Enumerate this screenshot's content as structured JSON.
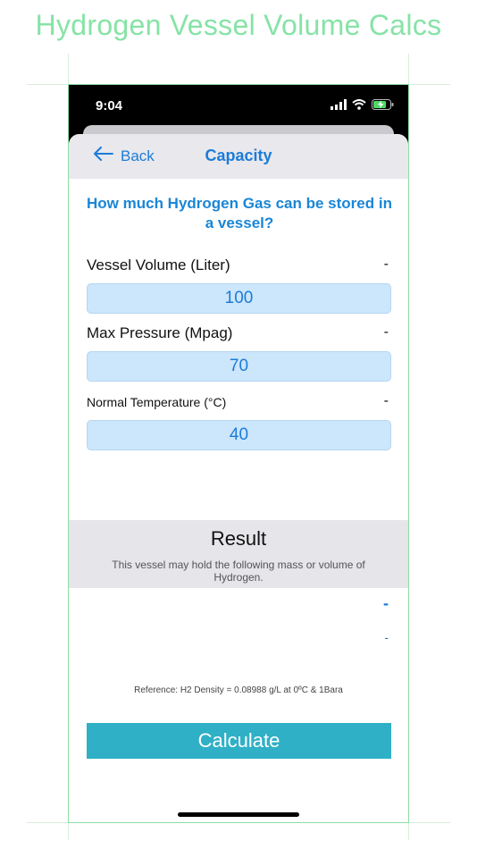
{
  "promo_title": "Hydrogen Vessel Volume Calcs",
  "status_bar": {
    "time": "9:04",
    "icons": [
      "signal-icon",
      "wifi-icon",
      "battery-charging-icon"
    ]
  },
  "nav": {
    "back_label": "Back",
    "title": "Capacity"
  },
  "question": "How much Hydrogen Gas can be stored in a vessel?",
  "fields": [
    {
      "label": "Vessel Volume (Liter)",
      "value": "100",
      "dash": "-"
    },
    {
      "label": "Max Pressure (Mpag)",
      "value": "70",
      "dash": "-"
    },
    {
      "label": "Normal Temperature (°C)",
      "value": "40",
      "dash": "-"
    }
  ],
  "result": {
    "title": "Result",
    "description": "This vessel may hold the following mass or volume of Hydrogen.",
    "mass_value": "-",
    "volume_value": "-"
  },
  "reference": "Reference: H2 Density = 0.08988 g/L at 0ºC & 1Bara",
  "calculate_label": "Calculate",
  "colors": {
    "accent": "#1c7cd6",
    "button": "#2fb0c6",
    "promo": "#86e3a6",
    "input_bg": "#cce6fb"
  }
}
